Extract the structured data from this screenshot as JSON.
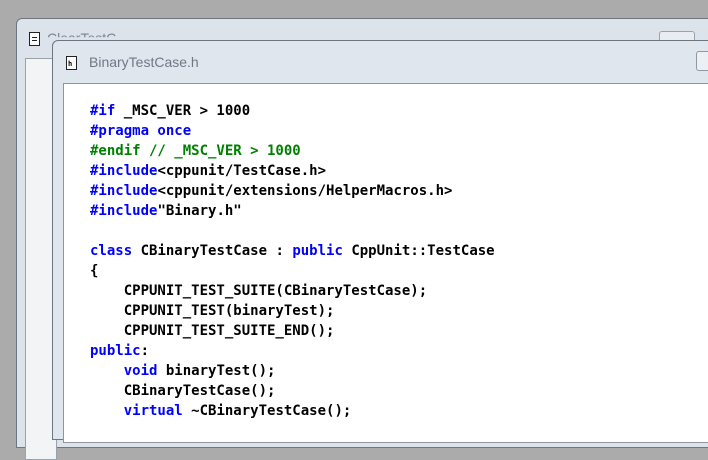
{
  "colors": {
    "keyword": "#0000ff",
    "comment": "#008000",
    "text": "#000000",
    "editor_background": "#ffffff",
    "desktop": "#ababab"
  },
  "back_window": {
    "title": "ClearTestC..",
    "icon": "document-icon"
  },
  "front_window": {
    "title": "BinaryTestCase.h",
    "icon": "header-file-icon"
  },
  "code_lines": [
    [
      {
        "t": "#if ",
        "c": "blue"
      },
      {
        "t": "_MSC_VER > 1000",
        "c": "plain"
      }
    ],
    [
      {
        "t": "#pragma once",
        "c": "blue"
      }
    ],
    [
      {
        "t": "#endif // _MSC_VER > 1000",
        "c": "green"
      }
    ],
    [
      {
        "t": "#include",
        "c": "blue"
      },
      {
        "t": "<cppunit/TestCase.h>",
        "c": "plain"
      }
    ],
    [
      {
        "t": "#include",
        "c": "blue"
      },
      {
        "t": "<cppunit/extensions/HelperMacros.h>",
        "c": "plain"
      }
    ],
    [
      {
        "t": "#include",
        "c": "blue"
      },
      {
        "t": "\"Binary.h\"",
        "c": "plain"
      }
    ],
    [],
    [
      {
        "t": "class",
        "c": "blue"
      },
      {
        "t": " CBinaryTestCase : ",
        "c": "plain"
      },
      {
        "t": "public",
        "c": "blue"
      },
      {
        "t": " CppUnit::TestCase",
        "c": "plain"
      }
    ],
    [
      {
        "t": "{",
        "c": "plain"
      }
    ],
    [
      {
        "t": "    CPPUNIT_TEST_SUITE(CBinaryTestCase);",
        "c": "plain"
      }
    ],
    [
      {
        "t": "    CPPUNIT_TEST(binaryTest);",
        "c": "plain"
      }
    ],
    [
      {
        "t": "    CPPUNIT_TEST_SUITE_END();",
        "c": "plain"
      }
    ],
    [
      {
        "t": "public",
        "c": "blue"
      },
      {
        "t": ":",
        "c": "plain"
      }
    ],
    [
      {
        "t": "    ",
        "c": "plain"
      },
      {
        "t": "void",
        "c": "blue"
      },
      {
        "t": " binaryTest();",
        "c": "plain"
      }
    ],
    [
      {
        "t": "    CBinaryTestCase();",
        "c": "plain"
      }
    ],
    [
      {
        "t": "    ",
        "c": "plain"
      },
      {
        "t": "virtual",
        "c": "blue"
      },
      {
        "t": " ~CBinaryTestCase();",
        "c": "plain"
      }
    ]
  ]
}
